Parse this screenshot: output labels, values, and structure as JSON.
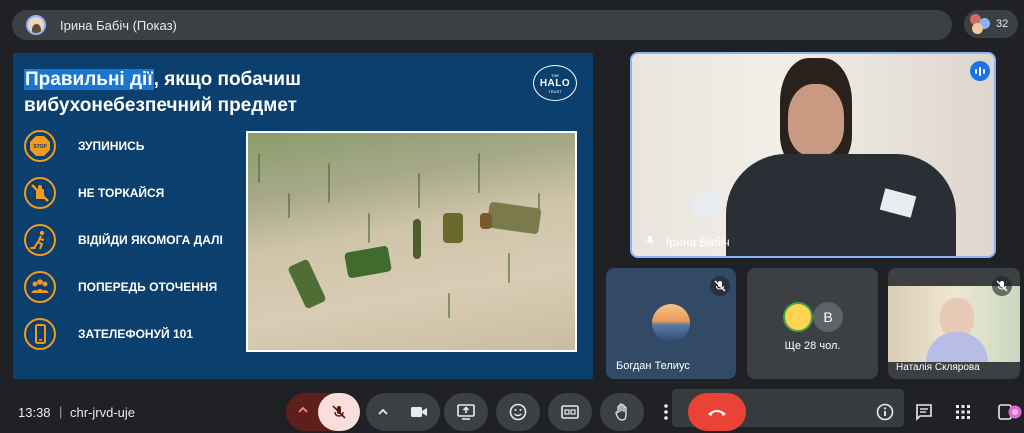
{
  "top_bar": {
    "presenter_title": "Ірина Бабіч (Показ)",
    "participant_count": "32"
  },
  "slide": {
    "title_highlight": "Правильні дії",
    "title_rest_line1": ", якщо побачиш",
    "title_line2": "вибухонебезпечний предмет",
    "logo_top": "THE",
    "logo_main": "HALO",
    "logo_bottom": "TRUST",
    "stop_sign_text": "STOP",
    "rules": [
      {
        "label": "ЗУПИНИСЬ",
        "icon": "stop-sign-icon"
      },
      {
        "label": "НЕ ТОРКАЙСЯ",
        "icon": "no-touch-icon"
      },
      {
        "label": "ВІДІЙДИ ЯКОМОГА ДАЛІ",
        "icon": "walk-away-icon"
      },
      {
        "label": "ПОПЕРЕДЬ ОТОЧЕННЯ",
        "icon": "people-icon"
      },
      {
        "label": "ЗАТЕЛЕФОНУЙ 101",
        "icon": "phone-icon"
      }
    ]
  },
  "tiles": {
    "main_speaker_name": "Ірина Бабіч",
    "tile1_name": "Богдан Телиус",
    "tile2_label": "Ще 28 чол.",
    "tile2_avatar_letter": "B",
    "tile3_name": "Наталія Склярова"
  },
  "bottom_bar": {
    "time": "13:38",
    "separator": "|",
    "meeting_code": "chr-jrvd-uje"
  },
  "colors": {
    "slide_bg": "#0a3f6e",
    "accent_orange": "#f29a1e",
    "highlight_blue": "#1976d2",
    "end_call_red": "#ea4335",
    "speaking_blue": "#1a73e8"
  }
}
